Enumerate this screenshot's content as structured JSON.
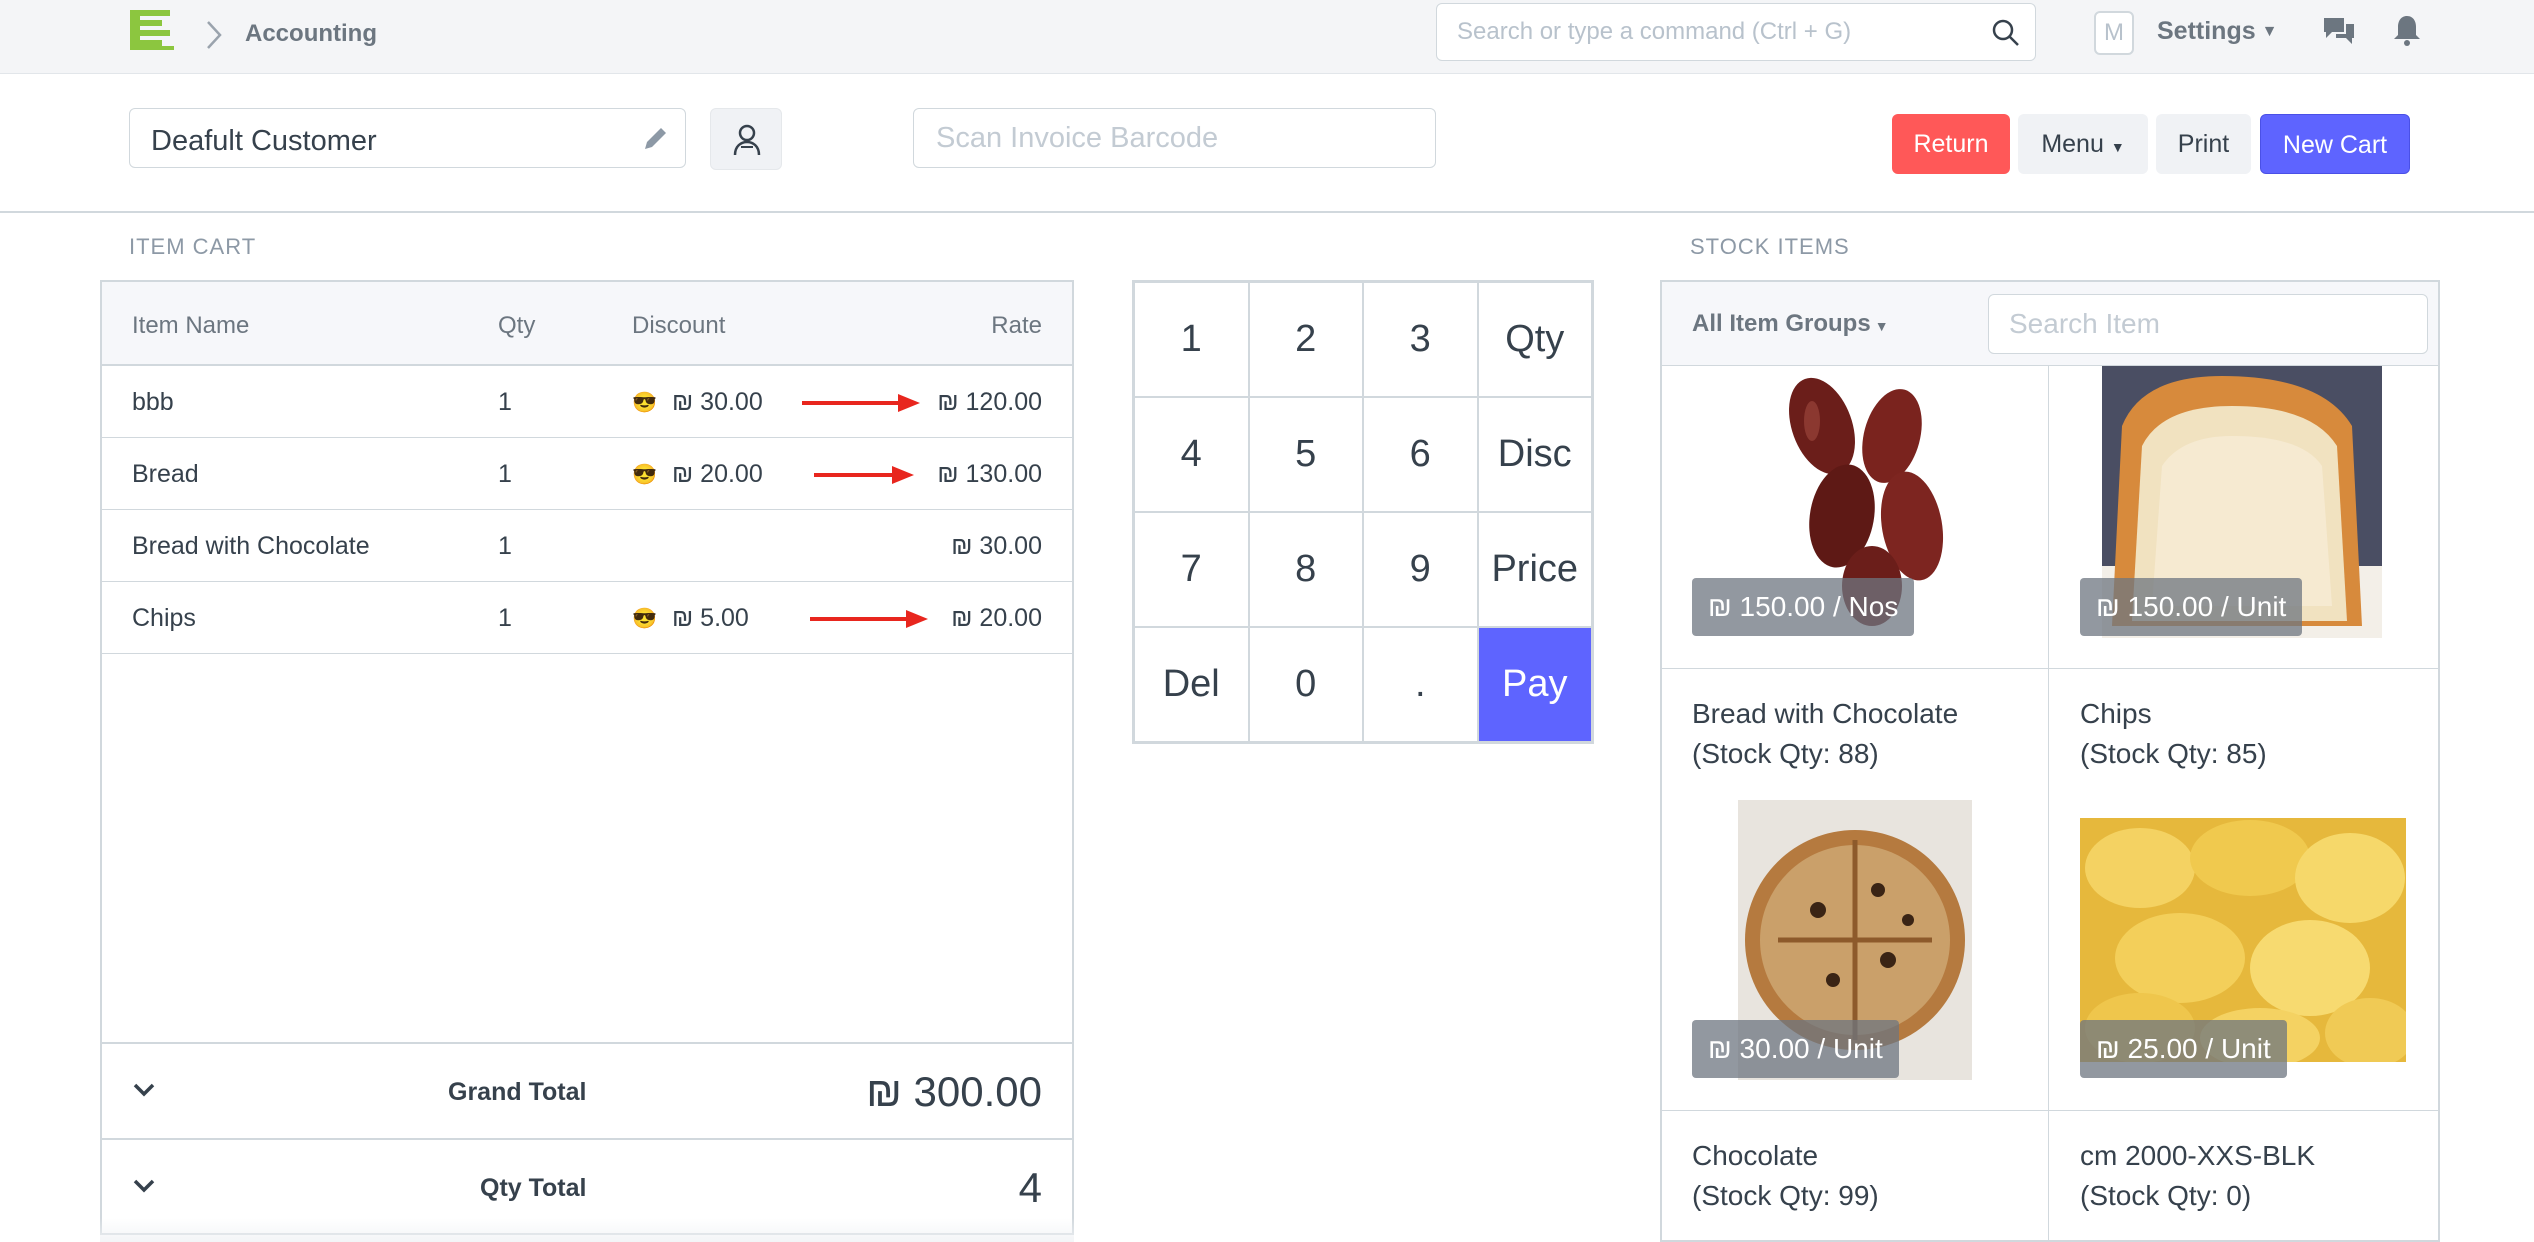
{
  "navbar": {
    "breadcrumb": "Accounting",
    "search_placeholder": "Search or type a command (Ctrl + G)",
    "avatar_letter": "M",
    "settings_label": "Settings"
  },
  "toolbar": {
    "customer": "Deafult Customer",
    "barcode_placeholder": "Scan Invoice Barcode",
    "return_label": "Return",
    "menu_label": "Menu",
    "print_label": "Print",
    "new_cart_label": "New Cart"
  },
  "cart": {
    "section_label": "ITEM CART",
    "columns": {
      "name": "Item Name",
      "qty": "Qty",
      "discount": "Discount",
      "rate": "Rate"
    },
    "rows": [
      {
        "name": "bbb",
        "qty": "1",
        "emoji": "😎",
        "discount": "₪ 30.00",
        "rate": "₪ 120.00"
      },
      {
        "name": "Bread",
        "qty": "1",
        "emoji": "😎",
        "discount": "₪ 20.00",
        "rate": "₪ 130.00"
      },
      {
        "name": "Bread with Chocolate",
        "qty": "1",
        "emoji": "",
        "discount": "",
        "rate": "₪ 30.00"
      },
      {
        "name": "Chips",
        "qty": "1",
        "emoji": "😎",
        "discount": "₪ 5.00",
        "rate": "₪ 20.00"
      }
    ],
    "grand_total_label": "Grand Total",
    "grand_total_value": "₪ 300.00",
    "qty_total_label": "Qty Total",
    "qty_total_value": "4"
  },
  "keypad": {
    "keys": [
      "1",
      "2",
      "3",
      "Qty",
      "4",
      "5",
      "6",
      "Disc",
      "7",
      "8",
      "9",
      "Price",
      "Del",
      "0",
      ".",
      "Pay"
    ]
  },
  "stock": {
    "section_label": "STOCK ITEMS",
    "groups_label": "All Item Groups",
    "search_placeholder": "Search Item",
    "items": [
      {
        "name": "",
        "stock": "",
        "price": "₪ 150.00 / Nos"
      },
      {
        "name": "",
        "stock": "",
        "price": "₪ 150.00 / Unit"
      },
      {
        "name": "Bread with Chocolate",
        "stock": "(Stock Qty: 88)",
        "price": "₪ 30.00 / Unit"
      },
      {
        "name": "Chips",
        "stock": "(Stock Qty: 85)",
        "price": "₪ 25.00 / Unit"
      },
      {
        "name": "Chocolate",
        "stock": "(Stock Qty: 99)",
        "price": ""
      },
      {
        "name": "cm 2000-XXS-BLK",
        "stock": "(Stock Qty: 0)",
        "price": ""
      }
    ]
  },
  "colors": {
    "accent": "#5e64ff",
    "return": "#ff5858",
    "arrow": "#e8261e"
  }
}
